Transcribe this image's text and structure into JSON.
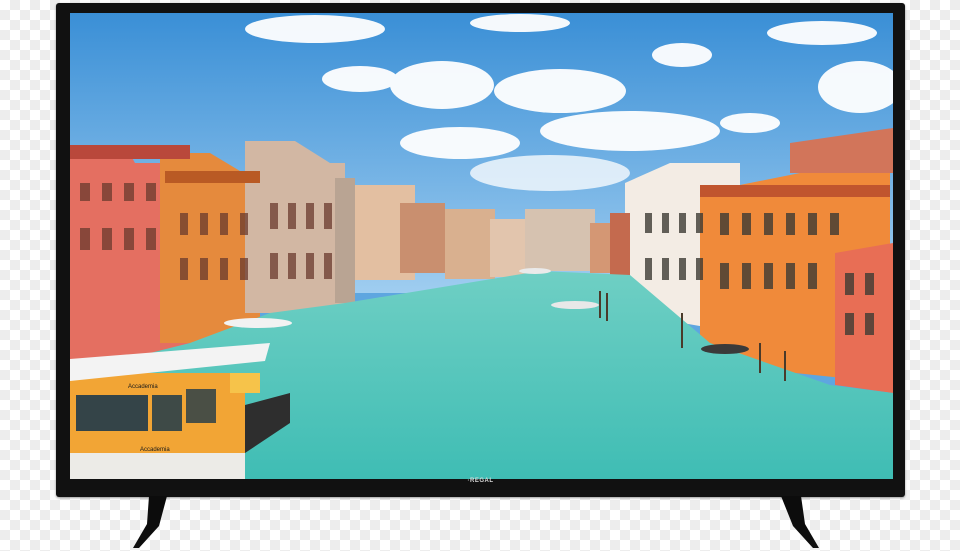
{
  "tv": {
    "brand_label": "·REGAL",
    "scene": "venice-grand-canal",
    "colors": {
      "bezel": "#111111",
      "sky": "#5ea6e0",
      "water": "#4fc4bb"
    }
  },
  "boat_sign": {
    "upper": "Accademia",
    "lower": "Accademia"
  }
}
